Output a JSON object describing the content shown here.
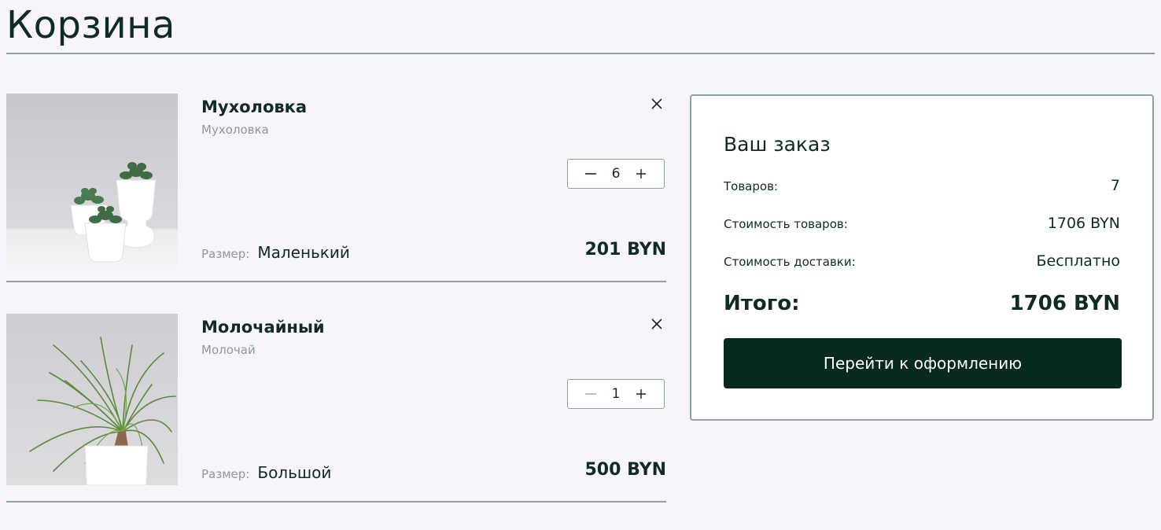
{
  "page": {
    "title": "Корзина"
  },
  "cart": {
    "items": [
      {
        "name": "Мухоловка",
        "subtitle": "Мухоловка",
        "quantity": "6",
        "size_label": "Размер:",
        "size_value": "Маленький",
        "price": "201 BYN",
        "image": "succulents-in-white-pots"
      },
      {
        "name": "Молочайный",
        "subtitle": "Молочай",
        "quantity": "1",
        "size_label": "Размер:",
        "size_value": "Большой",
        "price": "500 BYN",
        "image": "ponytail-palm-in-white-pot"
      }
    ]
  },
  "order": {
    "title": "Ваш заказ",
    "items_label": "Товаров:",
    "items_value": "7",
    "goods_cost_label": "Стоимость товаров:",
    "goods_cost_value": "1706 BYN",
    "delivery_label": "Стоимость доставки:",
    "delivery_value": "Бесплатно",
    "total_label": "Итого:",
    "total_value": "1706 BYN",
    "checkout_label": "Перейти к оформлению"
  },
  "icons": {
    "remove": "close-icon",
    "decrease": "minus-icon",
    "increase": "plus-icon"
  },
  "colors": {
    "background": "#f7f4fc",
    "text": "#0f2b22",
    "muted": "#8b9a95",
    "border": "#8aa59a",
    "button": "#08291e",
    "button_text": "#ffffff"
  }
}
